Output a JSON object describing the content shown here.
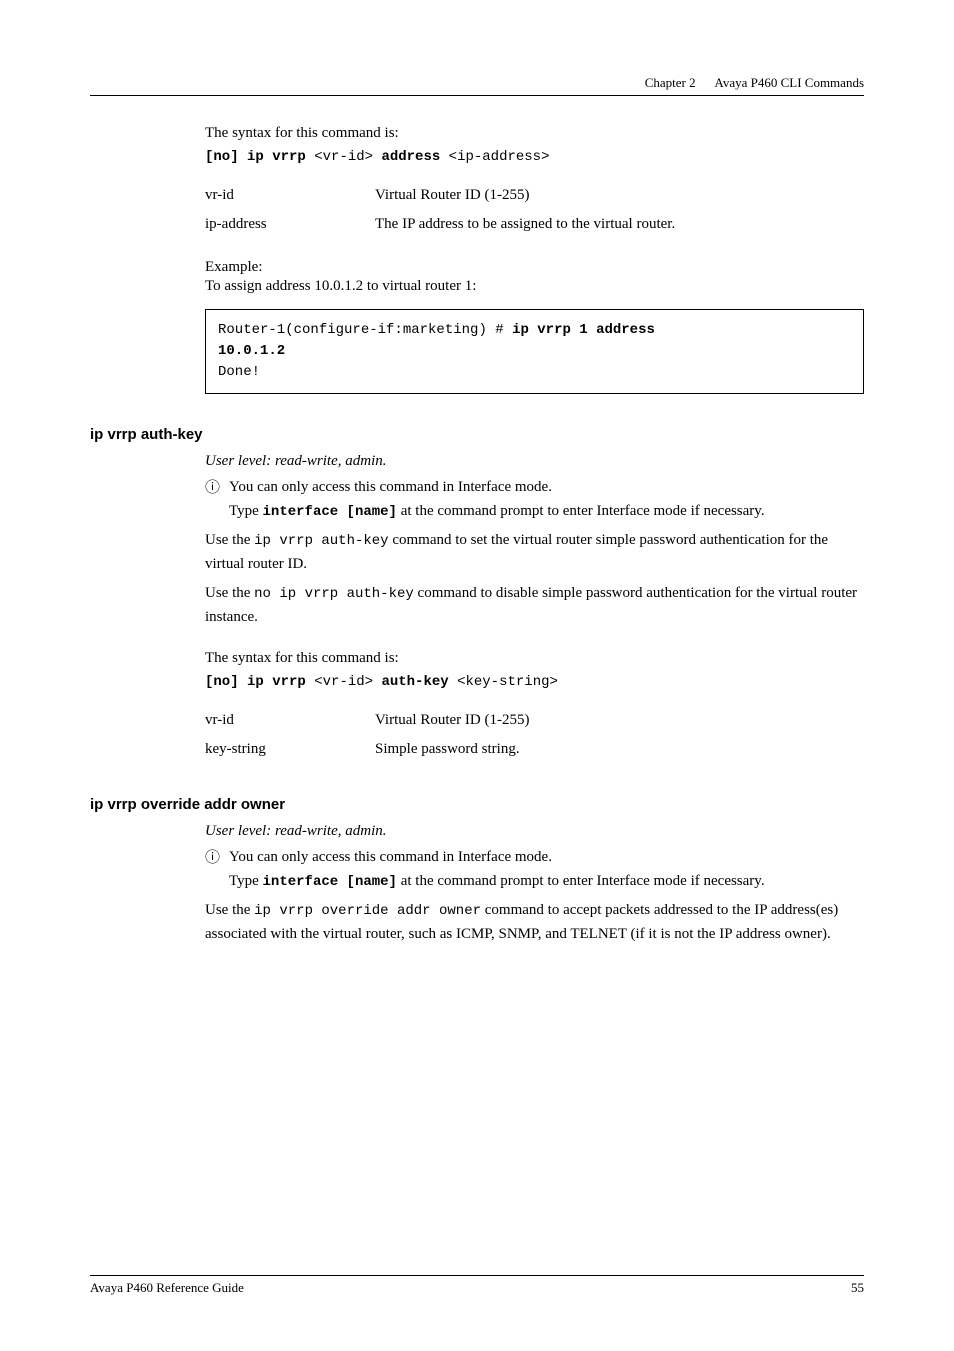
{
  "header": {
    "chapter": "Chapter 2",
    "title": "Avaya P460 CLI Commands"
  },
  "section1": {
    "syntax_intro": "The syntax for this command is:",
    "cmd_prefix": "[no] ip vrrp",
    "cmd_arg1": "<vr-id>",
    "cmd_kw2": "address",
    "cmd_arg2": "<ip-address>",
    "row1_term": "vr-id",
    "row1_def": "Virtual Router ID (1-255)",
    "row2_term": "ip-address",
    "row2_def": "The IP address to be assigned to the virtual router.",
    "example_label": "Example:",
    "example_desc": "To assign address 10.0.1.2 to virtual router 1:",
    "code_prefix": "Router-1(configure-if:marketing) # ",
    "code_bold1": "ip vrrp 1 address ",
    "code_bold2": "10.0.1.2",
    "code_last": "Done!"
  },
  "section2": {
    "heading": "ip vrrp auth-key",
    "user_level": "User level: read-write, admin.",
    "note_icon": "ⓘ",
    "note_line1": "You can only access this command in Interface mode.",
    "note_line2a": "Type ",
    "note_line2b": "interface [name]",
    "note_line2c": " at the command prompt to enter Interface mode if necessary.",
    "para1a": "Use the ",
    "para1b": "ip vrrp auth-key",
    "para1c": " command to set the virtual router simple password authentication for the virtual router ID.",
    "para2a": "Use the ",
    "para2b": "no ip vrrp auth-key",
    "para2c": " command to disable simple password authentication for the virtual router instance.",
    "syntax_intro": "The syntax for this command is:",
    "cmd_prefix": "[no] ip vrrp",
    "cmd_arg1": "<vr-id>",
    "cmd_kw2": "auth-key",
    "cmd_arg2": "<key-string>",
    "row1_term": "vr-id",
    "row1_def": "Virtual Router ID (1-255)",
    "row2_term": "key-string",
    "row2_def": "Simple password string."
  },
  "section3": {
    "heading": "ip vrrp override addr owner",
    "user_level": "User level: read-write, admin.",
    "note_icon": "ⓘ",
    "note_line1": "You can only access this command in Interface mode.",
    "note_line2a": "Type ",
    "note_line2b": "interface [name]",
    "note_line2c": " at the command prompt to enter Interface mode if necessary.",
    "para1a": "Use the ",
    "para1b": "ip vrrp override addr owner",
    "para1c": " command to accept packets addressed to the IP address(es) associated with the virtual router, such as ICMP, SNMP, and TELNET (if it is not the IP address owner)."
  },
  "footer": {
    "left": "Avaya P460 Reference Guide",
    "right": "55"
  }
}
